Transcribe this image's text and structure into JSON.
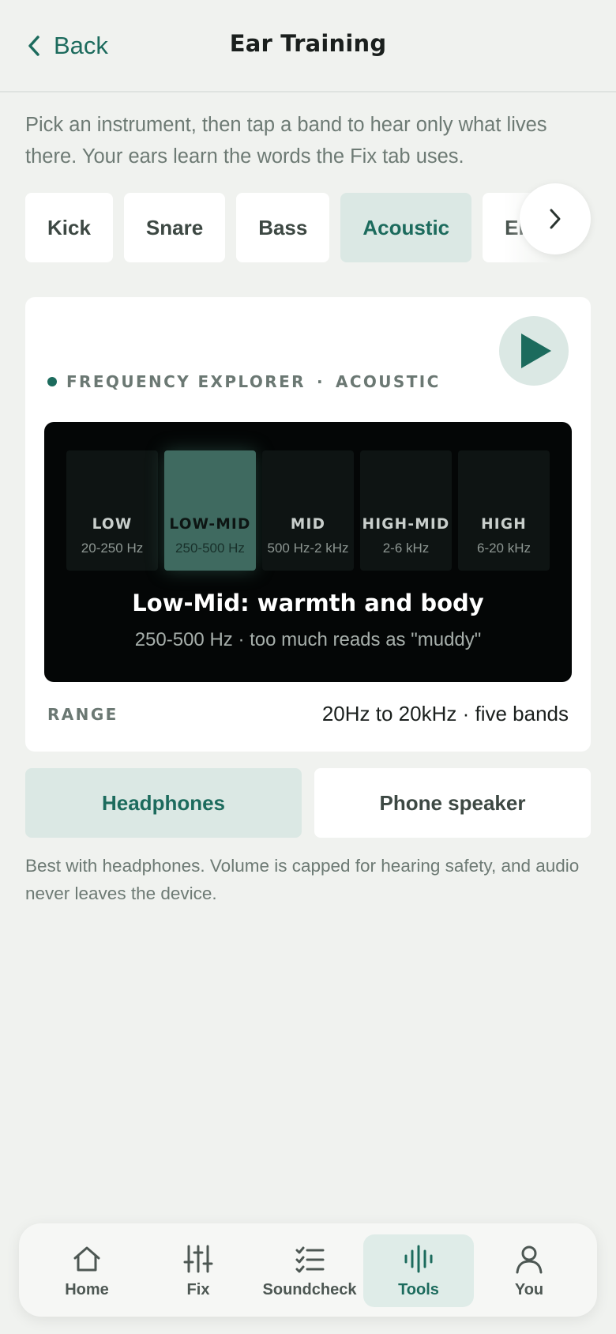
{
  "header": {
    "back_label": "Back",
    "title": "Ear Training"
  },
  "intro": "Pick an instrument, then tap a band to hear only what lives there. Your ears learn the words the Fix tab uses.",
  "instruments": [
    {
      "label": "Kick",
      "active": false
    },
    {
      "label": "Snare",
      "active": false
    },
    {
      "label": "Bass",
      "active": false
    },
    {
      "label": "Acoustic",
      "active": true
    },
    {
      "label": "Electric",
      "active": false
    }
  ],
  "explorer": {
    "label": "FREQUENCY EXPLORER",
    "separator": "·",
    "instrument": "ACOUSTIC",
    "bands": [
      {
        "name": "LOW",
        "range": "20-250 Hz"
      },
      {
        "name": "LOW-MID",
        "range": "250-500 Hz"
      },
      {
        "name": "MID",
        "range": "500 Hz-2 kHz"
      },
      {
        "name": "HIGH-MID",
        "range": "2-6 kHz"
      },
      {
        "name": "HIGH",
        "range": "6-20 kHz"
      }
    ],
    "selected_band": 1,
    "selected_title": "Low-Mid: warmth and body",
    "selected_detail": "250-500 Hz · too much reads as \"muddy\"",
    "range_label": "RANGE",
    "range_value": "20Hz to 20kHz · five bands"
  },
  "output": {
    "headphones_label": "Headphones",
    "speaker_label": "Phone speaker",
    "selected": "headphones"
  },
  "note": "Best with headphones. Volume is capped for hearing safety, and audio never leaves the device.",
  "tabbar": {
    "home": "Home",
    "fix": "Fix",
    "soundcheck": "Soundcheck",
    "tools": "Tools",
    "you": "You",
    "active": "tools"
  },
  "colors": {
    "accent": "#1c6b5d",
    "accent_soft": "#dbe8e4",
    "background": "#f0f2ef",
    "screen": "#040606"
  }
}
